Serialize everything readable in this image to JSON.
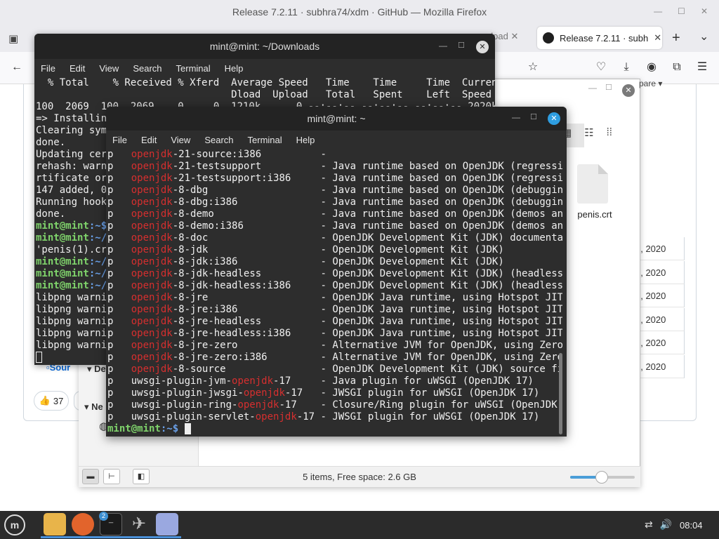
{
  "firefox": {
    "window_title": "Release 7.2.11 · subhra74/xdm · GitHub — Mozilla Firefox",
    "active_tab_title": "Release 7.2.11 · subh",
    "prev_tab_fragment": "nload",
    "tab_close": "✕",
    "new_tab": "+",
    "chevron": "⌄"
  },
  "github": {
    "dates": [
      "1, 2020",
      "3, 2020",
      "0, 2020",
      "1, 2020",
      "1, 2020",
      "1, 2020"
    ],
    "reaction_count": "37",
    "compare_label": "pare",
    "source_fragment": "Sour"
  },
  "file_manager": {
    "file_name": "penis.crt",
    "status": "5 items, Free space: 2.6 GB",
    "sidebar_labels": [
      "De",
      "Ne"
    ],
    "zoom_level": 0.5
  },
  "terminal_back": {
    "title": "mint@mint: ~/Downloads",
    "menu": [
      "File",
      "Edit",
      "View",
      "Search",
      "Terminal",
      "Help"
    ],
    "header1": "  % Total    % Received % Xferd  Average Speed   Time    Time     Time  Current",
    "header2": "                                 Dload  Upload   Total   Spent    Left  Speed",
    "line_partial": "100  2069  100  2069    0     0  1210k      0 --:--:-- --:--:-- --:--:-- 2020k",
    "lines": [
      "=> Installing",
      "Clearing syml",
      "done.",
      "Updating certi",
      "rehash: warnin",
      "rtificate or",
      "147 added, 0 r",
      "Running hooks",
      "done."
    ],
    "prompt_user": "mint@mint",
    "prompt_paths": [
      ":~$",
      ":~/D",
      ":~/D",
      ":~/D",
      ":~/D"
    ],
    "crt_line": "'penis(1).crt",
    "libpng": "libpng warnin"
  },
  "terminal_front": {
    "title": "mint@mint: ~",
    "menu": [
      "File",
      "Edit",
      "View",
      "Search",
      "Terminal",
      "Help"
    ],
    "rows": [
      {
        "p": "p",
        "pre": "",
        "red": "openjdk",
        "post": "-21-source:i386",
        "desc": "-"
      },
      {
        "p": "p",
        "pre": "",
        "red": "openjdk",
        "post": "-21-testsupport",
        "desc": "- Java runtime based on OpenJDK (regression"
      },
      {
        "p": "p",
        "pre": "",
        "red": "openjdk",
        "post": "-21-testsupport:i386",
        "desc": "- Java runtime based on OpenJDK (regression"
      },
      {
        "p": "p",
        "pre": "",
        "red": "openjdk",
        "post": "-8-dbg",
        "desc": "- Java runtime based on OpenJDK (debugging s"
      },
      {
        "p": "p",
        "pre": "",
        "red": "openjdk",
        "post": "-8-dbg:i386",
        "desc": "- Java runtime based on OpenJDK (debugging s"
      },
      {
        "p": "p",
        "pre": "",
        "red": "openjdk",
        "post": "-8-demo",
        "desc": "- Java runtime based on OpenJDK (demos and e"
      },
      {
        "p": "p",
        "pre": "",
        "red": "openjdk",
        "post": "-8-demo:i386",
        "desc": "- Java runtime based on OpenJDK (demos and e"
      },
      {
        "p": "p",
        "pre": "",
        "red": "openjdk",
        "post": "-8-doc",
        "desc": "- OpenJDK Development Kit (JDK) documentatio"
      },
      {
        "p": "p",
        "pre": "",
        "red": "openjdk",
        "post": "-8-jdk",
        "desc": "- OpenJDK Development Kit (JDK)"
      },
      {
        "p": "p",
        "pre": "",
        "red": "openjdk",
        "post": "-8-jdk:i386",
        "desc": "- OpenJDK Development Kit (JDK)"
      },
      {
        "p": "p",
        "pre": "",
        "red": "openjdk",
        "post": "-8-jdk-headless",
        "desc": "- OpenJDK Development Kit (JDK) (headless)"
      },
      {
        "p": "p",
        "pre": "",
        "red": "openjdk",
        "post": "-8-jdk-headless:i386",
        "desc": "- OpenJDK Development Kit (JDK) (headless)"
      },
      {
        "p": "p",
        "pre": "",
        "red": "openjdk",
        "post": "-8-jre",
        "desc": "- OpenJDK Java runtime, using Hotspot JIT"
      },
      {
        "p": "p",
        "pre": "",
        "red": "openjdk",
        "post": "-8-jre:i386",
        "desc": "- OpenJDK Java runtime, using Hotspot JIT"
      },
      {
        "p": "p",
        "pre": "",
        "red": "openjdk",
        "post": "-8-jre-headless",
        "desc": "- OpenJDK Java runtime, using Hotspot JIT (h"
      },
      {
        "p": "p",
        "pre": "",
        "red": "openjdk",
        "post": "-8-jre-headless:i386",
        "desc": "- OpenJDK Java runtime, using Hotspot JIT (h"
      },
      {
        "p": "p",
        "pre": "",
        "red": "openjdk",
        "post": "-8-jre-zero",
        "desc": "- Alternative JVM for OpenJDK, using Zero"
      },
      {
        "p": "p",
        "pre": "",
        "red": "openjdk",
        "post": "-8-jre-zero:i386",
        "desc": "- Alternative JVM for OpenJDK, using Zero"
      },
      {
        "p": "p",
        "pre": "",
        "red": "openjdk",
        "post": "-8-source",
        "desc": "- OpenJDK Development Kit (JDK) source files"
      },
      {
        "p": "p",
        "pre": "uwsgi-plugin-jvm-",
        "red": "openjdk",
        "post": "-17",
        "desc": "- Java plugin for uWSGI (OpenJDK 17)"
      },
      {
        "p": "p",
        "pre": "uwsgi-plugin-jwsgi-",
        "red": "openjdk",
        "post": "-17",
        "desc": "- JWSGI plugin for uWSGI (OpenJDK 17)"
      },
      {
        "p": "p",
        "pre": "uwsgi-plugin-ring-",
        "red": "openjdk",
        "post": "-17",
        "desc": "- Closure/Ring plugin for uWSGI (OpenJDK 17)"
      },
      {
        "p": "p",
        "pre": "uwsgi-plugin-servlet-",
        "red": "openjdk",
        "post": "-17",
        "desc": "- JWSGI plugin for uWSGI (OpenJDK 17)"
      }
    ],
    "prompt_user": "mint@mint",
    "prompt_path": ":~$"
  },
  "taskbar": {
    "clock": "08:04",
    "badge": "2"
  },
  "colors": {
    "terminal_bg": "#2d2d2d",
    "prompt_green": "#7fd36b",
    "prompt_blue": "#6aa0e8",
    "match_red": "#d62f2f",
    "accent_blue": "#2e9de0"
  }
}
